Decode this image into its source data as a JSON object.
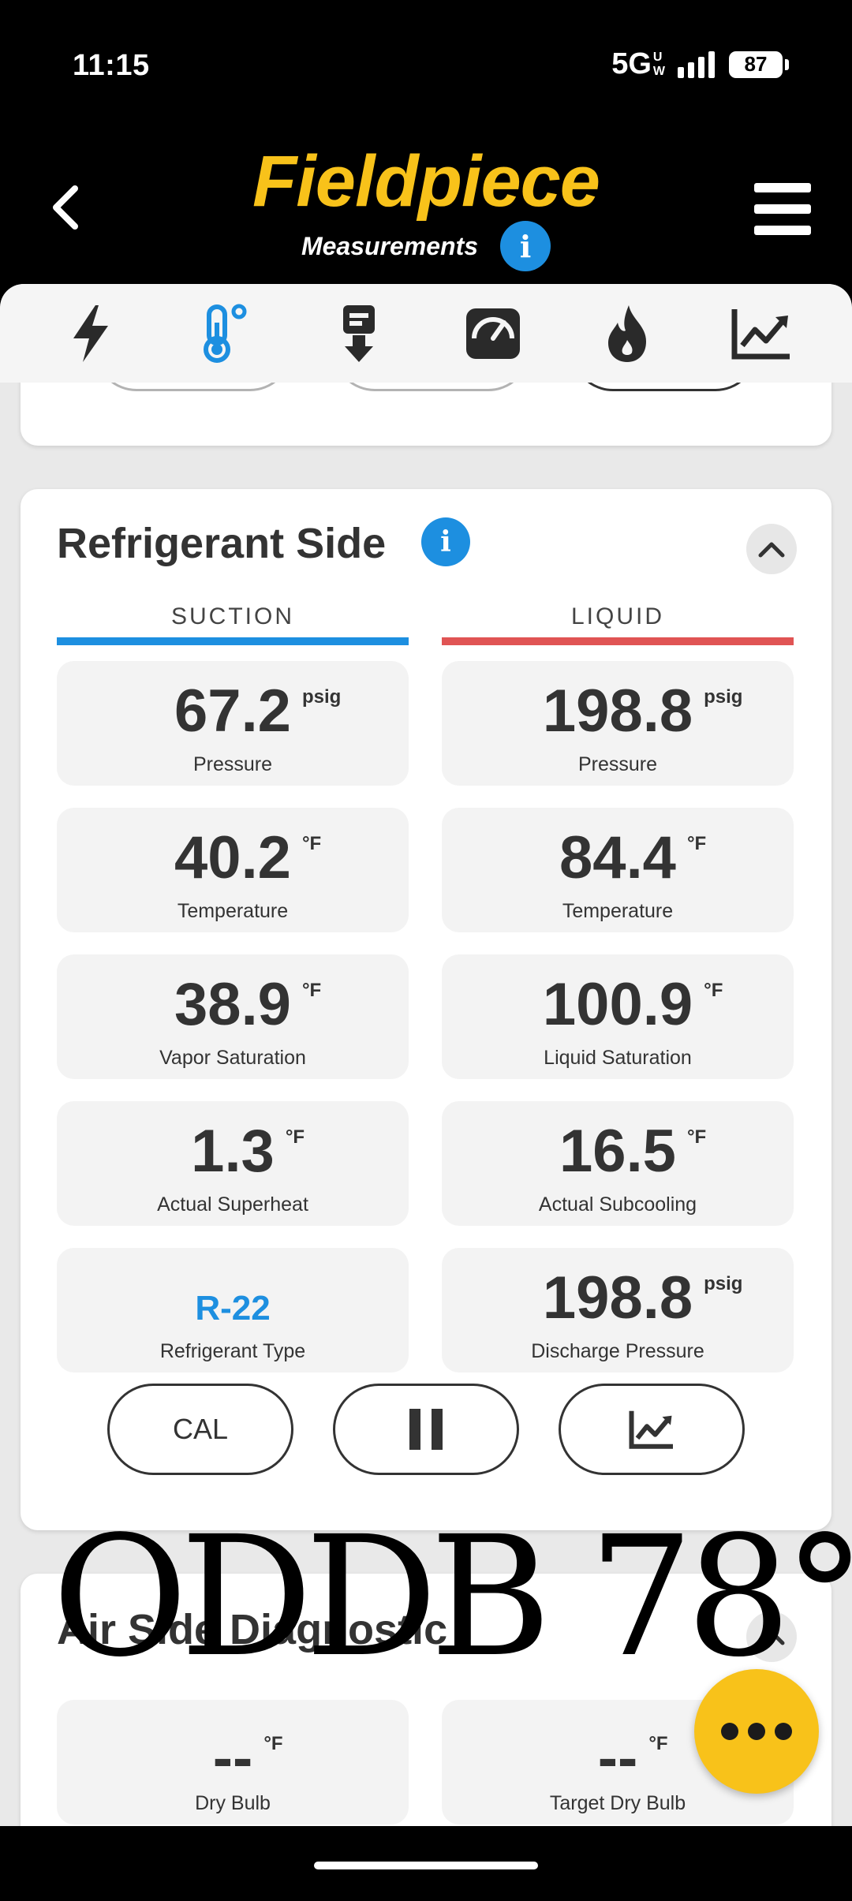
{
  "status": {
    "time": "11:15",
    "network": "5G",
    "network_sub_top": "U",
    "network_sub_bottom": "W",
    "battery": "87"
  },
  "header": {
    "logo": "Fieldpiece",
    "subtitle": "Measurements",
    "info_glyph": "i",
    "back_icon": "chevron-left-icon",
    "menu_icon": "hamburger-icon"
  },
  "tabs": [
    {
      "icon": "lightning-icon",
      "active": false
    },
    {
      "icon": "thermometer-icon",
      "active": true
    },
    {
      "icon": "download-meter-icon",
      "active": false
    },
    {
      "icon": "gauge-icon",
      "active": false
    },
    {
      "icon": "flame-icon",
      "active": false
    },
    {
      "icon": "chart-trend-icon",
      "active": false
    }
  ],
  "refrigerant": {
    "title": "Refrigerant Side",
    "suction_header": "SUCTION",
    "liquid_header": "LIQUID",
    "suction": [
      {
        "value": "67.2",
        "unit": "psig",
        "label": "Pressure"
      },
      {
        "value": "40.2",
        "unit": "°F",
        "label": "Temperature"
      },
      {
        "value": "38.9",
        "unit": "°F",
        "label": "Vapor Saturation"
      },
      {
        "value": "1.3",
        "unit": "°F",
        "label": "Actual Superheat"
      },
      {
        "value": "R-22",
        "unit": "",
        "label": "Refrigerant Type"
      }
    ],
    "liquid": [
      {
        "value": "198.8",
        "unit": "psig",
        "label": "Pressure"
      },
      {
        "value": "84.4",
        "unit": "°F",
        "label": "Temperature"
      },
      {
        "value": "100.9",
        "unit": "°F",
        "label": "Liquid Saturation"
      },
      {
        "value": "16.5",
        "unit": "°F",
        "label": "Actual Subcooling"
      },
      {
        "value": "198.8",
        "unit": "psig",
        "label": "Discharge Pressure"
      }
    ],
    "buttons": {
      "cal": "CAL",
      "pause_icon": "pause-icon",
      "chart_icon": "chart-trend-icon"
    }
  },
  "air_side": {
    "title": "Air Side Diagnostic",
    "tiles": [
      {
        "value": "--",
        "unit": "°F",
        "label": "Dry Bulb"
      },
      {
        "value": "--",
        "unit": "°F",
        "label": "Target Dry Bulb"
      }
    ]
  },
  "overlay": "ODDB 78°",
  "colors": {
    "brand_yellow": "#f8c21a",
    "info_blue": "#1d8fe0",
    "suction_blue": "#1d8fe0",
    "liquid_red": "#e05454",
    "background": "#e9e9e9"
  },
  "fab_icon": "more-dots-icon"
}
